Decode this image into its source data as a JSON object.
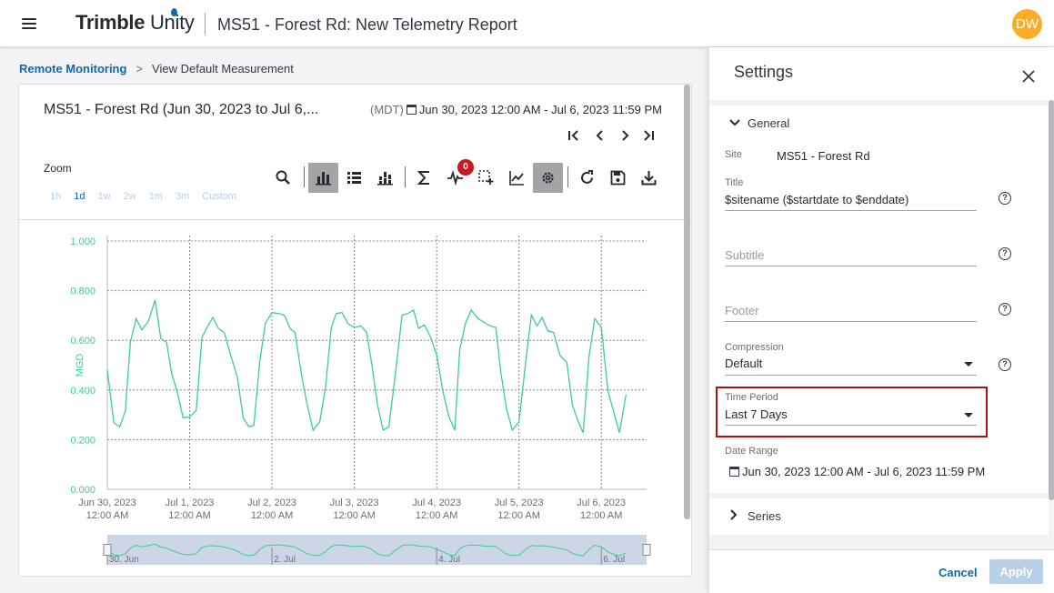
{
  "header": {
    "brand_bold": "Trimble",
    "brand_light": " Unity",
    "title": "MS51 - Forest Rd: New Telemetry Report",
    "avatar_initials": "DW",
    "avatar_color": "#fbad26"
  },
  "breadcrumb": {
    "link": "Remote Monitoring",
    "separator": ">",
    "current": "View Default Measurement"
  },
  "chart_card": {
    "title": "MS51 - Forest Rd (Jun 30, 2023 to Jul 6,...",
    "timezone": "(MDT)",
    "range": "Jun 30, 2023 12:00 AM - Jul 6, 2023 11:59 PM",
    "pager": {
      "first": "|<",
      "prev": "<",
      "next": ">",
      "last": ">|"
    },
    "zoom_label": "Zoom",
    "zoom_options": [
      "1h",
      "1d",
      "1w",
      "2w",
      "1m",
      "3m",
      "Custom"
    ],
    "zoom_active": "1d",
    "toolbar": [
      "search-icon",
      "bar-chart-icon",
      "list-icon",
      "stacked-bar-icon",
      "sum-icon",
      "pulse-icon",
      "add-region-icon",
      "line-chart-icon",
      "gear-icon",
      "refresh-icon",
      "save-icon",
      "download-icon"
    ],
    "alarm_count": "0"
  },
  "chart_data": {
    "type": "line",
    "ylabel": "MGD",
    "ylim": [
      0,
      1
    ],
    "y_ticks": [
      "0.000",
      "0.200",
      "0.400",
      "0.600",
      "0.800",
      "1.000"
    ],
    "x_ticks": [
      {
        "date": "Jun 30, 2023",
        "time": "12:00 AM"
      },
      {
        "date": "Jul 1, 2023",
        "time": "12:00 AM"
      },
      {
        "date": "Jul 2, 2023",
        "time": "12:00 AM"
      },
      {
        "date": "Jul 3, 2023",
        "time": "12:00 AM"
      },
      {
        "date": "Jul 4, 2023",
        "time": "12:00 AM"
      },
      {
        "date": "Jul 5, 2023",
        "time": "12:00 AM"
      },
      {
        "date": "Jul 6, 2023",
        "time": "12:00 AM"
      }
    ],
    "x_days": [
      0,
      6.55
    ],
    "series": [
      {
        "color": "#3ccc9a",
        "x": [
          0,
          0.08,
          0.15,
          0.22,
          0.28,
          0.35,
          0.42,
          0.5,
          0.58,
          0.65,
          0.72,
          0.78,
          0.85,
          0.92,
          1.0,
          1.08,
          1.15,
          1.22,
          1.28,
          1.35,
          1.42,
          1.5,
          1.58,
          1.65,
          1.72,
          1.78,
          1.85,
          1.92,
          2.0,
          2.08,
          2.15,
          2.22,
          2.28,
          2.35,
          2.42,
          2.5,
          2.58,
          2.65,
          2.72,
          2.78,
          2.85,
          2.92,
          3.0,
          3.08,
          3.15,
          3.22,
          3.28,
          3.35,
          3.42,
          3.5,
          3.58,
          3.65,
          3.72,
          3.78,
          3.85,
          3.92,
          4.0,
          4.08,
          4.15,
          4.22,
          4.28,
          4.35,
          4.42,
          4.5,
          4.58,
          4.65,
          4.72,
          4.78,
          4.85,
          4.92,
          5.0,
          5.08,
          5.15,
          5.22,
          5.28,
          5.35,
          5.42,
          5.5,
          5.58,
          5.65,
          5.72,
          5.78,
          5.85,
          5.92,
          6.0,
          6.08,
          6.15,
          6.22,
          6.3
        ],
        "y": [
          0.47,
          0.28,
          0.24,
          0.33,
          0.58,
          0.7,
          0.63,
          0.69,
          0.75,
          0.62,
          0.58,
          0.48,
          0.38,
          0.3,
          0.28,
          0.33,
          0.6,
          0.67,
          0.68,
          0.66,
          0.62,
          0.55,
          0.44,
          0.3,
          0.24,
          0.27,
          0.5,
          0.68,
          0.7,
          0.72,
          0.69,
          0.66,
          0.62,
          0.49,
          0.34,
          0.25,
          0.26,
          0.42,
          0.64,
          0.72,
          0.7,
          0.68,
          0.64,
          0.67,
          0.62,
          0.5,
          0.33,
          0.25,
          0.24,
          0.48,
          0.69,
          0.72,
          0.71,
          0.66,
          0.65,
          0.63,
          0.53,
          0.4,
          0.28,
          0.25,
          0.55,
          0.68,
          0.71,
          0.7,
          0.66,
          0.67,
          0.64,
          0.48,
          0.31,
          0.25,
          0.26,
          0.52,
          0.69,
          0.67,
          0.68,
          0.65,
          0.62,
          0.55,
          0.5,
          0.35,
          0.26,
          0.24,
          0.52,
          0.7,
          0.64,
          0.41,
          0.3,
          0.24,
          0.37
        ]
      }
    ],
    "navigator": {
      "labels": [
        {
          "text": "30. Jun",
          "day": 0
        },
        {
          "text": "2. Jul",
          "day": 2
        },
        {
          "text": "4. Jul",
          "day": 4
        },
        {
          "text": "6. Jul",
          "day": 6
        }
      ]
    }
  },
  "settings": {
    "title": "Settings",
    "general_label": "General",
    "site_label": "Site",
    "site_value": "MS51 - Forest Rd",
    "title_label": "Title",
    "title_value": "$sitename ($startdate to $enddate)",
    "subtitle_placeholder": "Subtitle",
    "footer_placeholder": "Footer",
    "compression_label": "Compression",
    "compression_value": "Default",
    "time_period_label": "Time Period",
    "time_period_value": "Last 7 Days",
    "date_range_label": "Date Range",
    "date_range_value": "Jun 30, 2023 12:00 AM - Jul 6, 2023 11:59 PM",
    "series_label": "Series",
    "cancel_label": "Cancel",
    "apply_label": "Apply",
    "help_glyph": "?"
  }
}
